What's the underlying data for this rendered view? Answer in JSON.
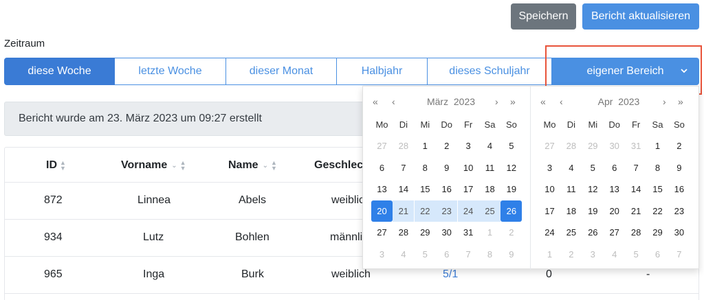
{
  "toolbar": {
    "save_label": "Speichern",
    "update_label": "Bericht aktualisieren"
  },
  "zeitraum": {
    "label": "Zeitraum",
    "options": [
      "diese Woche",
      "letzte Woche",
      "dieser Monat",
      "Halbjahr",
      "dieses Schuljahr",
      "eigener Bereich"
    ],
    "active": "diese Woche"
  },
  "info": {
    "text": "Bericht wurde am 23. März 2023 um 09:27 erstellt"
  },
  "table": {
    "headers": [
      "ID",
      "Vorname",
      "Name",
      "Geschlech"
    ],
    "rows": [
      {
        "id": "872",
        "vorname": "Linnea",
        "name": "Abels",
        "geschlecht": "weiblich",
        "extra": "",
        "count": "",
        "dash": ""
      },
      {
        "id": "934",
        "vorname": "Lutz",
        "name": "Bohlen",
        "geschlecht": "männli",
        "extra": "",
        "count": "",
        "dash": ""
      },
      {
        "id": "965",
        "vorname": "Inga",
        "name": "Burk",
        "geschlecht": "weiblich",
        "extra": "5/1",
        "count": "0",
        "dash": "-"
      }
    ]
  },
  "datepicker": {
    "nav": {
      "prev_year": "«",
      "prev_month": "‹",
      "next_month": "›",
      "next_year": "»"
    },
    "weekdays": [
      "Mo",
      "Di",
      "Mi",
      "Do",
      "Fr",
      "Sa",
      "So"
    ],
    "left": {
      "month": "März",
      "year": "2023",
      "weeks": [
        [
          "27",
          "28",
          "1",
          "2",
          "3",
          "4",
          "5"
        ],
        [
          "6",
          "7",
          "8",
          "9",
          "10",
          "11",
          "12"
        ],
        [
          "13",
          "14",
          "15",
          "16",
          "17",
          "18",
          "19"
        ],
        [
          "20",
          "21",
          "22",
          "23",
          "24",
          "25",
          "26"
        ],
        [
          "27",
          "28",
          "29",
          "30",
          "31",
          "1",
          "2"
        ],
        [
          "3",
          "4",
          "5",
          "6",
          "7",
          "8",
          "9"
        ]
      ]
    },
    "right": {
      "month": "Apr",
      "year": "2023",
      "weeks": [
        [
          "27",
          "28",
          "29",
          "30",
          "31",
          "1",
          "2"
        ],
        [
          "3",
          "4",
          "5",
          "6",
          "7",
          "8",
          "9"
        ],
        [
          "10",
          "11",
          "12",
          "13",
          "14",
          "15",
          "16"
        ],
        [
          "17",
          "18",
          "19",
          "20",
          "21",
          "22",
          "23"
        ],
        [
          "24",
          "25",
          "26",
          "27",
          "28",
          "29",
          "30"
        ],
        [
          "1",
          "2",
          "3",
          "4",
          "5",
          "6",
          "7"
        ]
      ]
    },
    "selection": {
      "start": "20",
      "end": "26"
    }
  },
  "colors": {
    "accent": "#4a90e2",
    "accent_dark": "#3a7bd5",
    "secondary": "#6c757d",
    "highlight": "#e8533a",
    "range": "#d6e8fb"
  }
}
